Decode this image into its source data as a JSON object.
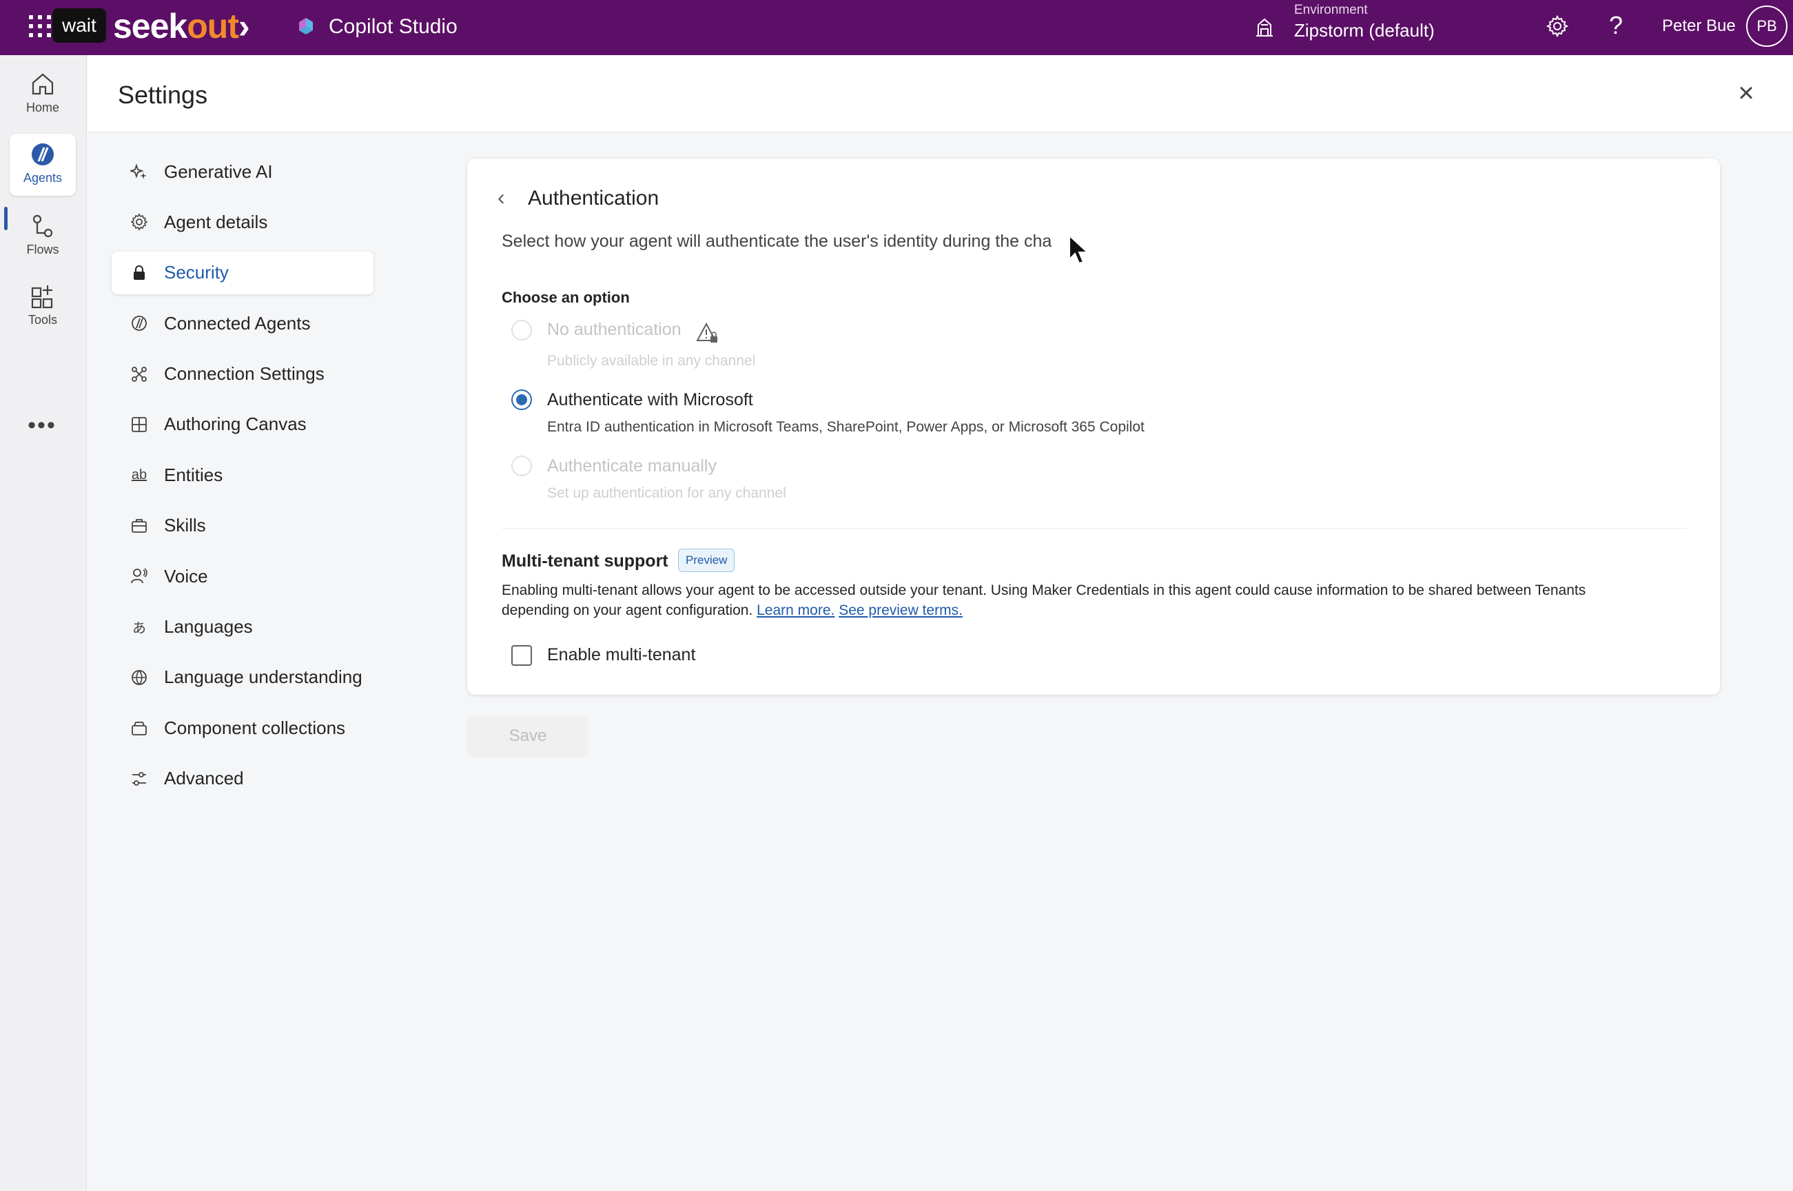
{
  "topbar": {
    "wait_badge": "wait",
    "brand_main": "seek",
    "brand_accent": "out",
    "brand_chevron": "›",
    "app_name": "Copilot Studio",
    "environment_label": "Environment",
    "environment_value": "Zipstorm (default)",
    "help_glyph": "?",
    "user_name": "Peter Bue",
    "user_initials": "PB",
    "background_color": "#5c0f66",
    "brand_accent_color": "#f08a2c"
  },
  "rail": {
    "items": [
      {
        "label": "Home",
        "icon": "home-icon"
      },
      {
        "label": "Agents",
        "icon": "agents-icon",
        "active": true
      },
      {
        "label": "Flows",
        "icon": "flows-icon"
      },
      {
        "label": "Tools",
        "icon": "tools-icon"
      }
    ],
    "more": "•••"
  },
  "settings": {
    "title": "Settings",
    "close_glyph": "×",
    "nav": [
      {
        "label": "Generative AI",
        "icon": "sparkle-icon"
      },
      {
        "label": "Agent details",
        "icon": "gear-icon"
      },
      {
        "label": "Security",
        "icon": "lock-icon",
        "active": true
      },
      {
        "label": "Connected Agents",
        "icon": "connected-agents-icon"
      },
      {
        "label": "Connection Settings",
        "icon": "connection-icon"
      },
      {
        "label": "Authoring Canvas",
        "icon": "canvas-icon"
      },
      {
        "label": "Entities",
        "icon": "entities-icon",
        "glyph": "ab"
      },
      {
        "label": "Skills",
        "icon": "skills-icon"
      },
      {
        "label": "Voice",
        "icon": "voice-icon"
      },
      {
        "label": "Languages",
        "icon": "languages-icon",
        "glyph": "あ"
      },
      {
        "label": "Language understanding",
        "icon": "language-understanding-icon"
      },
      {
        "label": "Component collections",
        "icon": "component-collections-icon"
      },
      {
        "label": "Advanced",
        "icon": "advanced-icon"
      }
    ]
  },
  "auth": {
    "back_glyph": "‹",
    "title": "Authentication",
    "description": "Select how your agent will authenticate the user's identity during the cha",
    "choose_label": "Choose an option",
    "options": [
      {
        "label": "No authentication",
        "sub": "Publicly available in any channel",
        "state": "disabled"
      },
      {
        "label": "Authenticate with Microsoft",
        "sub": "Entra ID authentication in Microsoft Teams, SharePoint, Power Apps, or Microsoft 365 Copilot",
        "state": "selected"
      },
      {
        "label": "Authenticate manually",
        "sub": "Set up authentication for any channel",
        "state": "disabled"
      }
    ],
    "multitenant": {
      "title": "Multi-tenant support",
      "badge": "Preview",
      "description_line1": "Enabling multi-tenant allows your agent to be accessed outside your tenant. Using Maker Credentials in this agent could cause information to be shared between Tenants",
      "description_line2": "depending on your agent configuration.",
      "learn_more": "Learn more.",
      "preview_terms": "See preview terms.",
      "checkbox_label": "Enable multi-tenant",
      "checked": false
    },
    "save_label": "Save",
    "accent_color": "#2b6cb0"
  }
}
